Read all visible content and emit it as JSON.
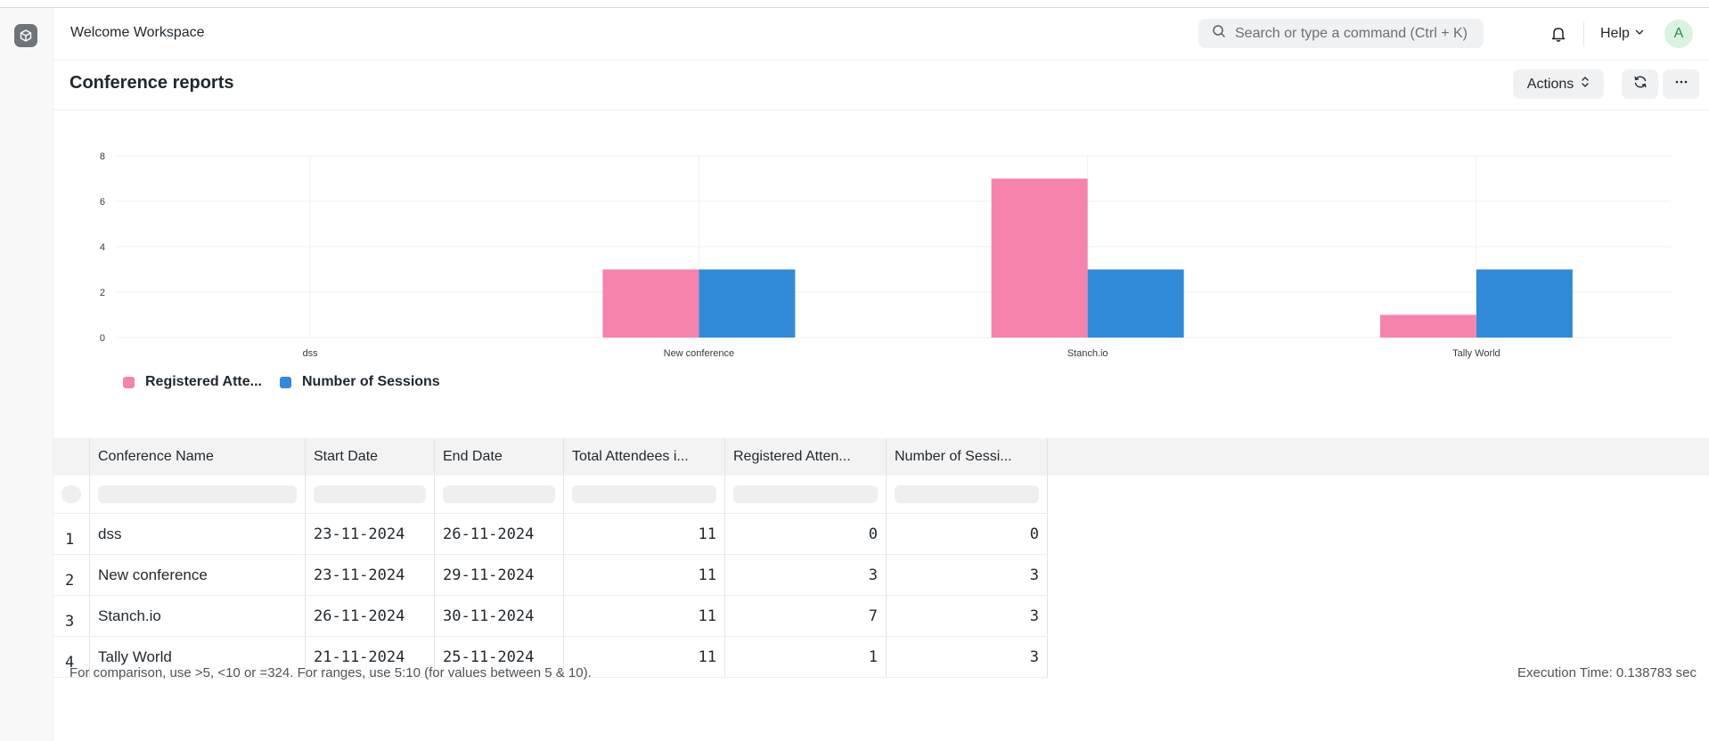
{
  "workspace": {
    "title": "Welcome Workspace"
  },
  "search": {
    "placeholder": "Search or type a command (Ctrl + K)"
  },
  "navbar": {
    "help_label": "Help",
    "avatar_initial": "A"
  },
  "page": {
    "title": "Conference reports",
    "actions_label": "Actions"
  },
  "colors": {
    "registered": "#f683ae",
    "sessions": "#318ad8"
  },
  "chart_data": {
    "type": "bar",
    "categories": [
      "dss",
      "New conference",
      "Stanch.io",
      "Tally World"
    ],
    "series": [
      {
        "name": "Registered Atte...",
        "values": [
          0,
          3,
          7,
          1
        ]
      },
      {
        "name": "Number of Sessions",
        "values": [
          0,
          3,
          3,
          3
        ]
      }
    ],
    "y_ticks": [
      "0",
      "2",
      "4",
      "6",
      "8"
    ],
    "ylim": [
      0,
      8
    ],
    "grid": true,
    "legend_position": "bottom-left"
  },
  "table": {
    "columns": [
      "Conference Name",
      "Start Date",
      "End Date",
      "Total Attendees i...",
      "Registered Atten...",
      "Number of Sessi..."
    ],
    "rows": [
      {
        "index": "1",
        "name": "dss",
        "start": "23-11-2024",
        "end": "26-11-2024",
        "total": "11",
        "registered": "0",
        "sessions": "0"
      },
      {
        "index": "2",
        "name": "New conference",
        "start": "23-11-2024",
        "end": "29-11-2024",
        "total": "11",
        "registered": "3",
        "sessions": "3"
      },
      {
        "index": "3",
        "name": "Stanch.io",
        "start": "26-11-2024",
        "end": "30-11-2024",
        "total": "11",
        "registered": "7",
        "sessions": "3"
      },
      {
        "index": "4",
        "name": "Tally World",
        "start": "21-11-2024",
        "end": "25-11-2024",
        "total": "11",
        "registered": "1",
        "sessions": "3"
      }
    ]
  },
  "footer": {
    "note": "For comparison, use >5, <10 or =324. For ranges, use 5:10 (for values between 5 & 10).",
    "execution_time": "Execution Time: 0.138783 sec"
  }
}
